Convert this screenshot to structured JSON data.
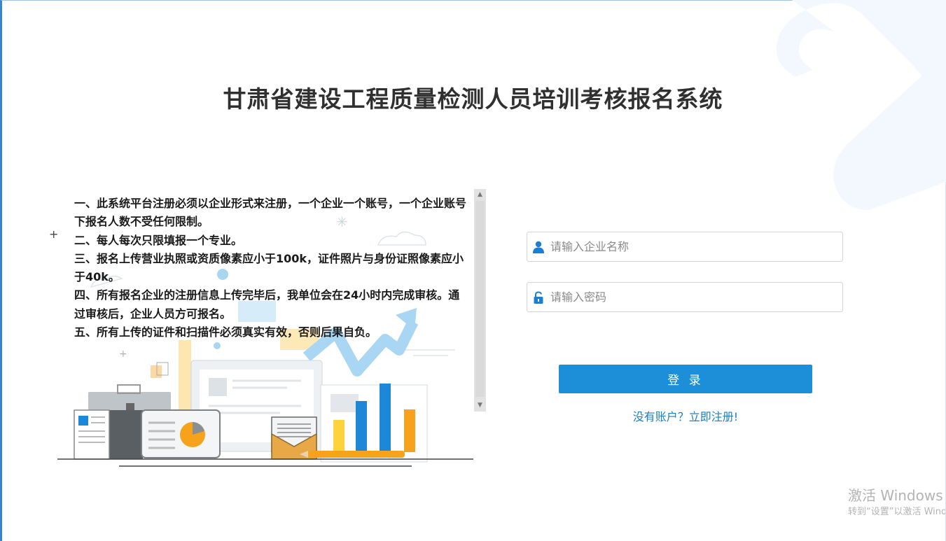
{
  "header": {
    "title": "甘肃省建设工程质量检测人员培训考核报名系统"
  },
  "notice": {
    "items": [
      "一、此系统平台注册必须以企业形式来注册，一个企业一个账号，一个企业账号下报名人数不受任何限制。",
      "二、每人每次只限填报一个专业。",
      "三、报名上传营业执照或资质像素应小于100k，证件照片与身份证照像素应小于40k。",
      "四、所有报名企业的注册信息上传完毕后，我单位会在24小时内完成审核。通过审核后，企业人员方可报名。",
      "五、所有上传的证件和扫描件必须真实有效，否则后果自负。"
    ]
  },
  "login": {
    "company_placeholder": "请输入企业名称",
    "password_placeholder": "请输入密码",
    "submit_label": "登 录",
    "register_link": "没有账户？立即注册!",
    "user_icon": "user-icon",
    "lock_icon": "lock-icon"
  },
  "watermark": {
    "title": "激活 Windows",
    "subtitle": "转到“设置”以激活 Windows。"
  },
  "colors": {
    "accent": "#1c8fd8",
    "link": "#1a7fc4",
    "title": "#303030"
  }
}
